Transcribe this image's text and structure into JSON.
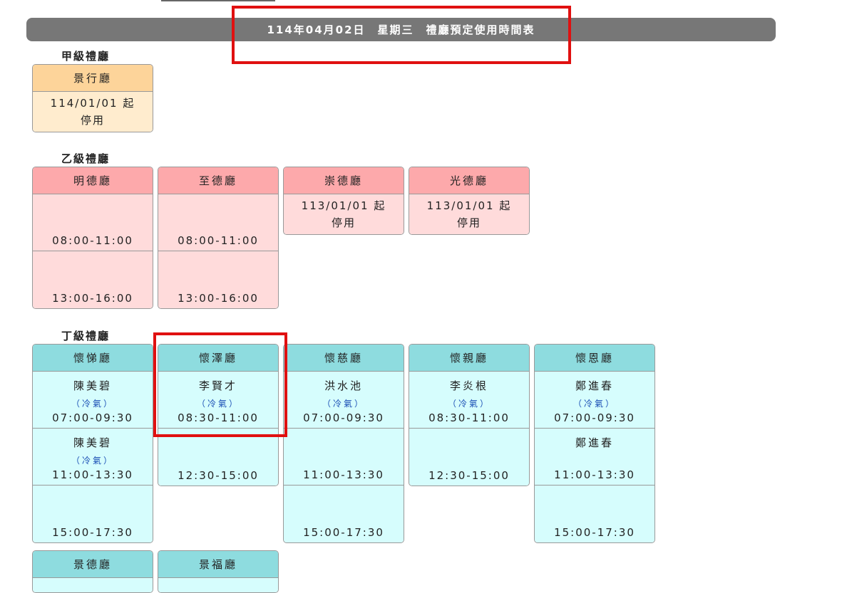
{
  "header": {
    "title": "114年04月02日　星期三　禮廳預定使用時間表"
  },
  "sections": {
    "jia": {
      "title": "甲級禮廳",
      "halls": [
        {
          "name": "景行廳",
          "closed_date": "114/01/01 起",
          "closed_text": "停用"
        }
      ]
    },
    "yi": {
      "title": "乙級禮廳",
      "halls": [
        {
          "name": "明德廳",
          "slots": [
            {
              "time": "08:00-11:00"
            },
            {
              "time": "13:00-16:00"
            }
          ]
        },
        {
          "name": "至德廳",
          "slots": [
            {
              "time": "08:00-11:00"
            },
            {
              "time": "13:00-16:00"
            }
          ]
        },
        {
          "name": "崇德廳",
          "closed_date": "113/01/01 起",
          "closed_text": "停用"
        },
        {
          "name": "光德廳",
          "closed_date": "113/01/01 起",
          "closed_text": "停用"
        }
      ]
    },
    "ding": {
      "title": "丁級禮廳",
      "halls": [
        {
          "name": "懷悌廳",
          "slots": [
            {
              "booker": "陳美碧",
              "ac": "（冷氣）",
              "time": "07:00-09:30"
            },
            {
              "booker": "陳美碧",
              "ac": "（冷氣）",
              "time": "11:00-13:30"
            },
            {
              "time": "15:00-17:30"
            }
          ]
        },
        {
          "name": "懷澤廳",
          "slots": [
            {
              "booker": "李賢才",
              "ac": "（冷氣）",
              "time": "08:30-11:00"
            },
            {
              "time": "12:30-15:00"
            }
          ]
        },
        {
          "name": "懷慈廳",
          "slots": [
            {
              "booker": "洪水池",
              "ac": "（冷氣）",
              "time": "07:00-09:30"
            },
            {
              "time": "11:00-13:30"
            },
            {
              "time": "15:00-17:30"
            }
          ]
        },
        {
          "name": "懷親廳",
          "slots": [
            {
              "booker": "李炎根",
              "ac": "（冷氣）",
              "time": "08:30-11:00"
            },
            {
              "time": "12:30-15:00"
            }
          ]
        },
        {
          "name": "懷恩廳",
          "slots": [
            {
              "booker": "鄭進春",
              "ac": "（冷氣）",
              "time": "07:00-09:30"
            },
            {
              "booker": "鄭進春",
              "time": "11:00-13:30"
            },
            {
              "time": "15:00-17:30"
            }
          ]
        },
        {
          "name": "景德廳"
        },
        {
          "name": "景福廳"
        }
      ]
    }
  },
  "colors": {
    "header_bg": "#777777",
    "annotation": "#e01010",
    "ac_text": "#1a4fb5"
  }
}
